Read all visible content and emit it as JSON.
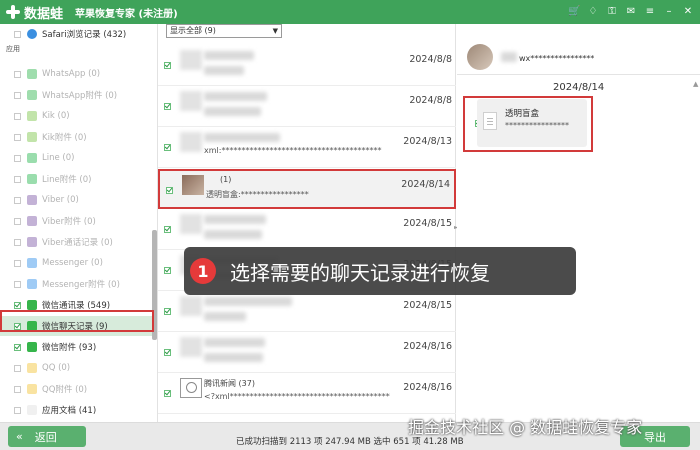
{
  "titlebar": {
    "logo_text": "数据蛙",
    "app_title": "苹果恢复专家 (未注册)",
    "icons": [
      "cart-icon",
      "bell-icon",
      "key-icon",
      "chat-icon",
      "menu-icon",
      "minimize-icon",
      "close-icon"
    ]
  },
  "sidebar": {
    "top_item": "Safari浏览记录 (432)",
    "section_label": "应用",
    "items": [
      {
        "label": "WhatsApp (0)",
        "color": "#2bb34a",
        "checked": false,
        "dim": true
      },
      {
        "label": "WhatsApp附件 (0)",
        "color": "#2bb34a",
        "checked": false,
        "dim": true
      },
      {
        "label": "Kik (0)",
        "color": "#78c442",
        "checked": false,
        "dim": true
      },
      {
        "label": "Kik附件 (0)",
        "color": "#78c442",
        "checked": false,
        "dim": true
      },
      {
        "label": "Line (0)",
        "color": "#1fb34a",
        "checked": false,
        "dim": true
      },
      {
        "label": "Line附件 (0)",
        "color": "#1fb34a",
        "checked": false,
        "dim": true
      },
      {
        "label": "Viber (0)",
        "color": "#7b54a4",
        "checked": false,
        "dim": true
      },
      {
        "label": "Viber附件 (0)",
        "color": "#7b54a4",
        "checked": false,
        "dim": true
      },
      {
        "label": "Viber通话记录 (0)",
        "color": "#7b54a4",
        "checked": false,
        "dim": true
      },
      {
        "label": "Messenger (0)",
        "color": "#2b8be8",
        "checked": false,
        "dim": true
      },
      {
        "label": "Messenger附件 (0)",
        "color": "#2b8be8",
        "checked": false,
        "dim": true
      },
      {
        "label": "微信通讯录 (549)",
        "color": "#36b54b",
        "checked": true,
        "dim": false
      },
      {
        "label": "微信聊天记录 (9)",
        "color": "#36b54b",
        "checked": true,
        "dim": false,
        "selected": true
      },
      {
        "label": "微信附件 (93)",
        "color": "#36b54b",
        "checked": true,
        "dim": false
      },
      {
        "label": "QQ (0)",
        "color": "#f2c12e",
        "checked": false,
        "dim": true
      },
      {
        "label": "QQ附件 (0)",
        "color": "#f2c12e",
        "checked": false,
        "dim": true
      },
      {
        "label": "应用文档 (41)",
        "color": "#f0f0f0",
        "checked": false,
        "dim": false
      }
    ]
  },
  "list": {
    "filter_value": "显示全部 (9)",
    "messages": [
      {
        "date": "2024/8/8",
        "name": "",
        "preview": ""
      },
      {
        "date": "2024/8/8",
        "name": "",
        "preview": ""
      },
      {
        "date": "2024/8/13",
        "name": "",
        "preview": "xml:****************************************"
      },
      {
        "date": "2024/8/14",
        "name": "(1)",
        "preview": "透明盲盒:*****************",
        "selected": true
      },
      {
        "date": "2024/8/15",
        "name": "",
        "preview": ""
      },
      {
        "date": "2024/8/15",
        "name": "",
        "preview": ""
      },
      {
        "date": "2024/8/15",
        "name": "",
        "preview": ""
      },
      {
        "date": "2024/8/16",
        "name": "",
        "preview": ""
      },
      {
        "date": "2024/8/16",
        "name": "腾讯新闻 (37)",
        "preview": "<?xml****************************************"
      }
    ]
  },
  "detail": {
    "contact": "wx****************",
    "date": "2024/8/14",
    "card_title": "透明盲盒",
    "card_sub": "****************"
  },
  "callout": {
    "number": "1",
    "text": "选择需要的聊天记录进行恢复"
  },
  "bottom": {
    "back_label": "返回",
    "status": "已成功扫描到 2113 项 247.94 MB   选中 651 项 41.28 MB",
    "export_label": "导出"
  },
  "watermark": "掘金技术社区 @ 数据蛙恢复专家"
}
